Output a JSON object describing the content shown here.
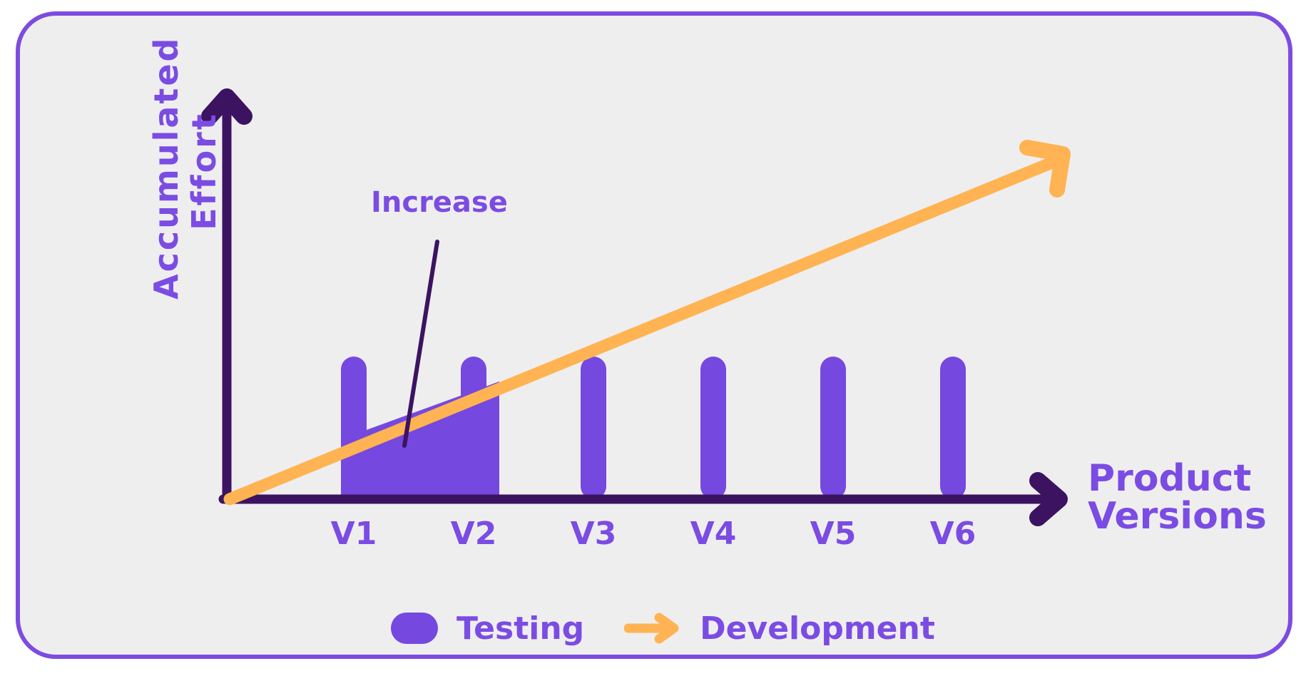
{
  "card": {
    "background_color": "#efeeef",
    "border_color": "#7c4ce0"
  },
  "axes": {
    "y_label": "Accumulated\nEffort",
    "x_label": "Product\nVersions",
    "axis_color": "#3c1361",
    "label_color": "#7b4ce3"
  },
  "annotation": {
    "label": "Increase",
    "leader_color": "#3c1361"
  },
  "legend": {
    "items": [
      {
        "label": "Testing",
        "marker": "rounded-rect",
        "color": "#7548e0"
      },
      {
        "label": "Development",
        "marker": "arrow",
        "color": "#ffb352"
      }
    ]
  },
  "chart_data": {
    "type": "bar",
    "title": "",
    "xlabel": "Product Versions",
    "ylabel": "Accumulated Effort",
    "categories": [
      "V1",
      "V2",
      "V3",
      "V4",
      "V5",
      "V6"
    ],
    "series": [
      {
        "name": "Testing",
        "type": "bar",
        "color": "#7548e0",
        "values": [
          1,
          1,
          1,
          1,
          1,
          1
        ]
      },
      {
        "name": "Development",
        "type": "line",
        "color": "#ffb352",
        "x": [
          0,
          6.6
        ],
        "values": [
          0,
          2.45
        ]
      }
    ],
    "annotations": [
      {
        "text": "Increase",
        "target": "shaded-area-between-V1-and-V2",
        "color": "#7b4ce3"
      }
    ],
    "shaded_region": {
      "label": "Increase",
      "from_category": "V1",
      "to_category": "V2",
      "color": "#7548e0"
    },
    "grid": false,
    "legend_position": "bottom-center",
    "ylim": [
      0,
      3
    ],
    "axis_arrows": true
  }
}
